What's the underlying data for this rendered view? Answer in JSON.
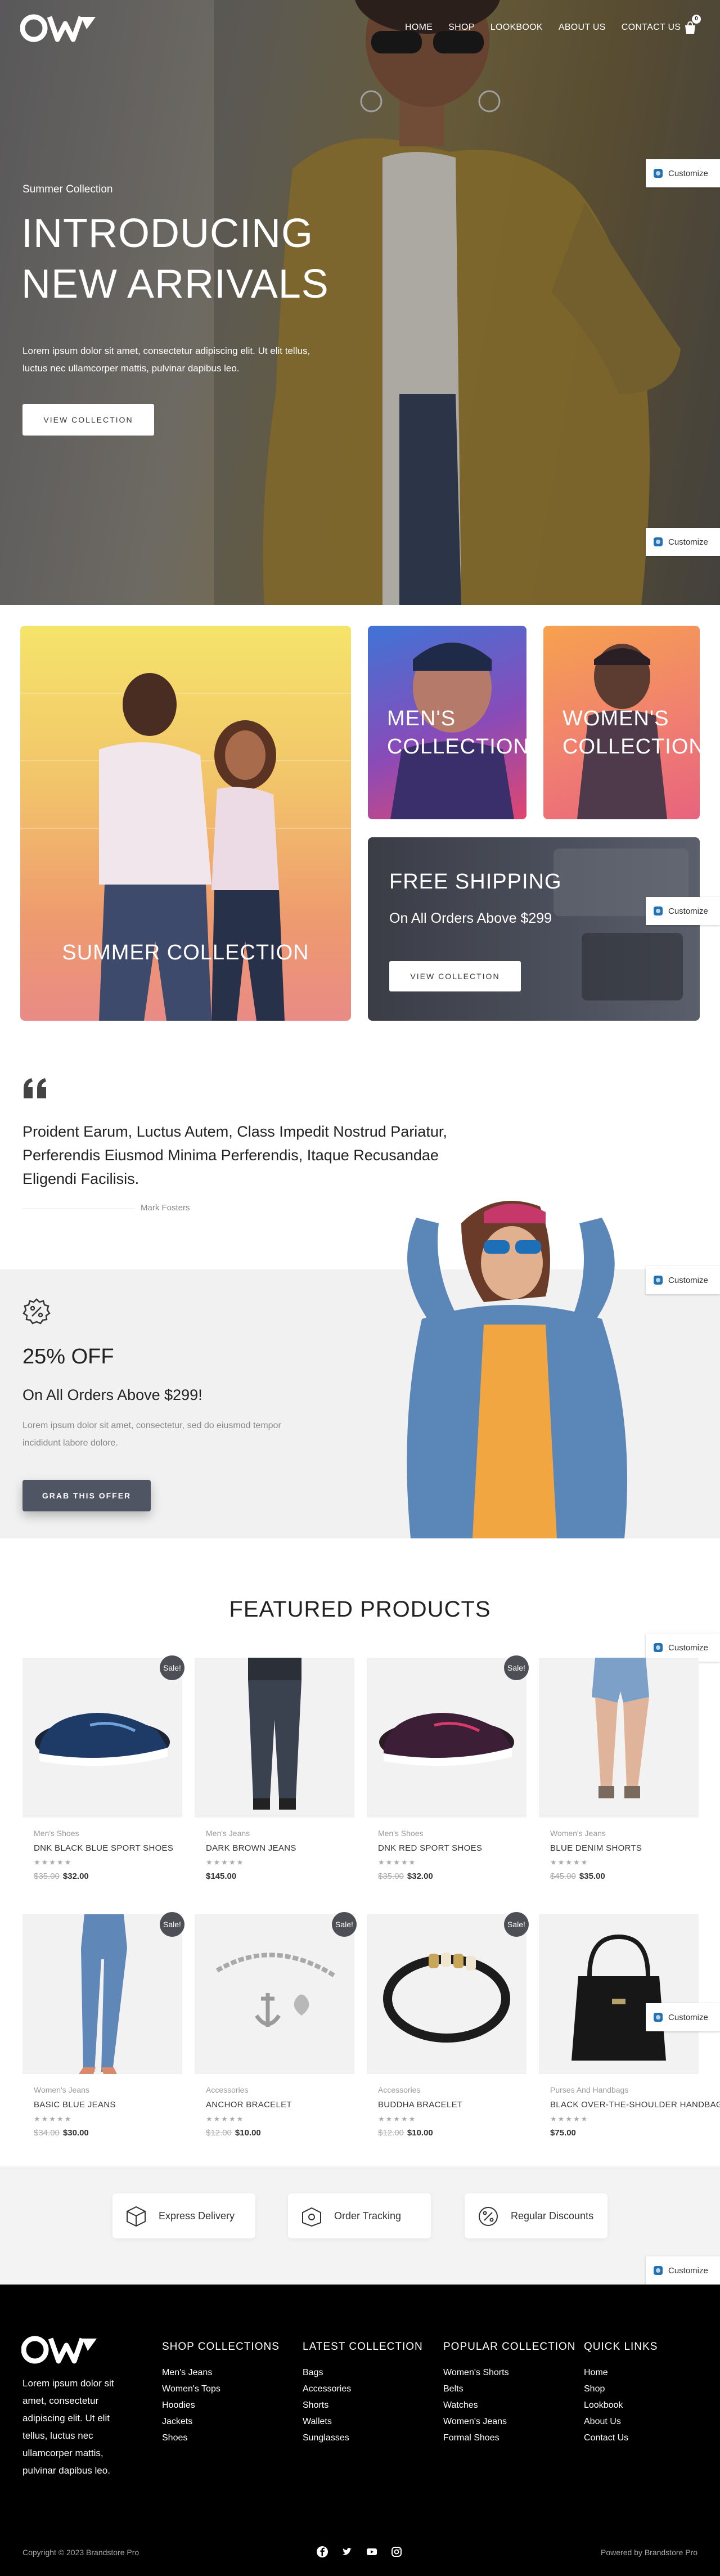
{
  "header": {
    "nav": [
      "HOME",
      "SHOP",
      "LOOKBOOK",
      "ABOUT US",
      "CONTACT US"
    ],
    "cart_count": "0"
  },
  "hero": {
    "kicker": "Summer Collection",
    "title_line1": "INTRODUCING",
    "title_line2": "NEW ARRIVALS",
    "text": "Lorem ipsum dolor sit amet, consectetur adipiscing elit. Ut elit tellus, luctus nec ullamcorper mattis, pulvinar dapibus leo.",
    "button": "VIEW COLLECTION"
  },
  "customize_label": "Customize",
  "categories": {
    "summer": "SUMMER COLLECTION",
    "mens": "MEN'S COLLECTION",
    "womens": "WOMEN'S COLLECTION",
    "shipping_title": "FREE SHIPPING",
    "shipping_sub": "On All Orders Above $299",
    "shipping_button": "VIEW COLLECTION"
  },
  "testimonial": {
    "text": "Proident Earum, Luctus Autem, Class Impedit Nostrud Pariatur, Perferendis Eiusmod Minima Perferendis, Itaque Recusandae Eligendi Facilisis.",
    "author": "Mark Fosters"
  },
  "offer": {
    "big": "25% OFF",
    "sub": "On All Orders Above $299!",
    "text": "Lorem ipsum dolor sit amet, consectetur, sed do eiusmod tempor incididunt labore dolore.",
    "button": "GRAB THIS OFFER"
  },
  "featured_title": "FEATURED PRODUCTS",
  "products": [
    {
      "category": "Men's Shoes",
      "name": "DNK BLACK BLUE SPORT SHOES",
      "old_price": "$35.00",
      "price": "$32.00",
      "sale": "Sale!"
    },
    {
      "category": "Men's Jeans",
      "name": "DARK BROWN JEANS",
      "old_price": "",
      "price": "$145.00",
      "sale": ""
    },
    {
      "category": "Men's Shoes",
      "name": "DNK RED SPORT SHOES",
      "old_price": "$35.00",
      "price": "$32.00",
      "sale": "Sale!"
    },
    {
      "category": "Women's Jeans",
      "name": "BLUE DENIM SHORTS",
      "old_price": "$45.00",
      "price": "$35.00",
      "sale": ""
    },
    {
      "category": "Women's Jeans",
      "name": "BASIC BLUE JEANS",
      "old_price": "$34.00",
      "price": "$30.00",
      "sale": "Sale!"
    },
    {
      "category": "Accessories",
      "name": "ANCHOR BRACELET",
      "old_price": "$12.00",
      "price": "$10.00",
      "sale": "Sale!"
    },
    {
      "category": "Accessories",
      "name": "BUDDHA BRACELET",
      "old_price": "$12.00",
      "price": "$10.00",
      "sale": "Sale!"
    },
    {
      "category": "Purses And Handbags",
      "name": "BLACK OVER-THE-SHOULDER HANDBAG",
      "old_price": "",
      "price": "$75.00",
      "sale": ""
    }
  ],
  "rating_stars": "★★★★★",
  "features": [
    "Express Delivery",
    "Order Tracking",
    "Regular Discounts"
  ],
  "footer": {
    "about": "Lorem ipsum dolor sit amet, consectetur adipiscing elit. Ut elit tellus, luctus nec ullamcorper mattis, pulvinar dapibus leo.",
    "columns": [
      {
        "title": "SHOP COLLECTIONS",
        "links": [
          "Men's Jeans",
          "Women's Tops",
          "Hoodies",
          "Jackets",
          "Shoes"
        ]
      },
      {
        "title": "LATEST COLLECTION",
        "links": [
          "Bags",
          "Accessories",
          "Shorts",
          "Wallets",
          "Sunglasses"
        ]
      },
      {
        "title": "POPULAR COLLECTION",
        "links": [
          "Women's Shorts",
          "Belts",
          "Watches",
          "Women's Jeans",
          "Formal Shoes"
        ]
      },
      {
        "title": "QUICK LINKS",
        "links": [
          "Home",
          "Shop",
          "Lookbook",
          "About Us",
          "Contact Us"
        ]
      }
    ],
    "copyright": "Copyright © 2023 Brandstore Pro",
    "powered": "Powered by Brandstore Pro"
  },
  "colors": {
    "dark_button": "#505563",
    "footer_bg": "#000000",
    "sale_badge": "#4d4f56",
    "customize_icon": "#2271b1"
  }
}
